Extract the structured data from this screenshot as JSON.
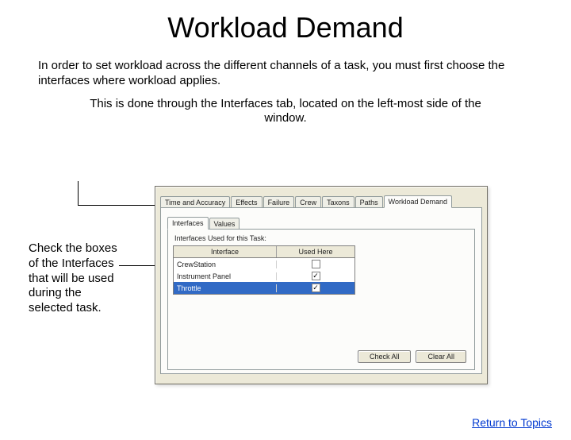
{
  "title": "Workload Demand",
  "intro": "In order to set workload across the different channels of a task, you must first choose the interfaces where workload applies.",
  "sub": "This is done through the Interfaces tab, located on the left-most side of the window.",
  "sidenote": "Check the boxes of the Interfaces that will be used during the selected task.",
  "link": "Return to Topics",
  "dialog": {
    "tabs": [
      "Time and Accuracy",
      "Effects",
      "Failure",
      "Crew",
      "Taxons",
      "Paths",
      "Workload Demand"
    ],
    "active_tab": "Workload Demand",
    "subtabs": [
      "Interfaces",
      "Values"
    ],
    "active_subtab": "Interfaces",
    "panel_label": "Interfaces Used for this Task:",
    "columns": [
      "Interface",
      "Used Here"
    ],
    "rows": [
      {
        "name": "CrewStation",
        "checked": false,
        "selected": false
      },
      {
        "name": "Instrument Panel",
        "checked": true,
        "selected": false
      },
      {
        "name": "Throttle",
        "checked": true,
        "selected": true
      }
    ],
    "buttons": {
      "check_all": "Check All",
      "clear_all": "Clear All"
    }
  }
}
